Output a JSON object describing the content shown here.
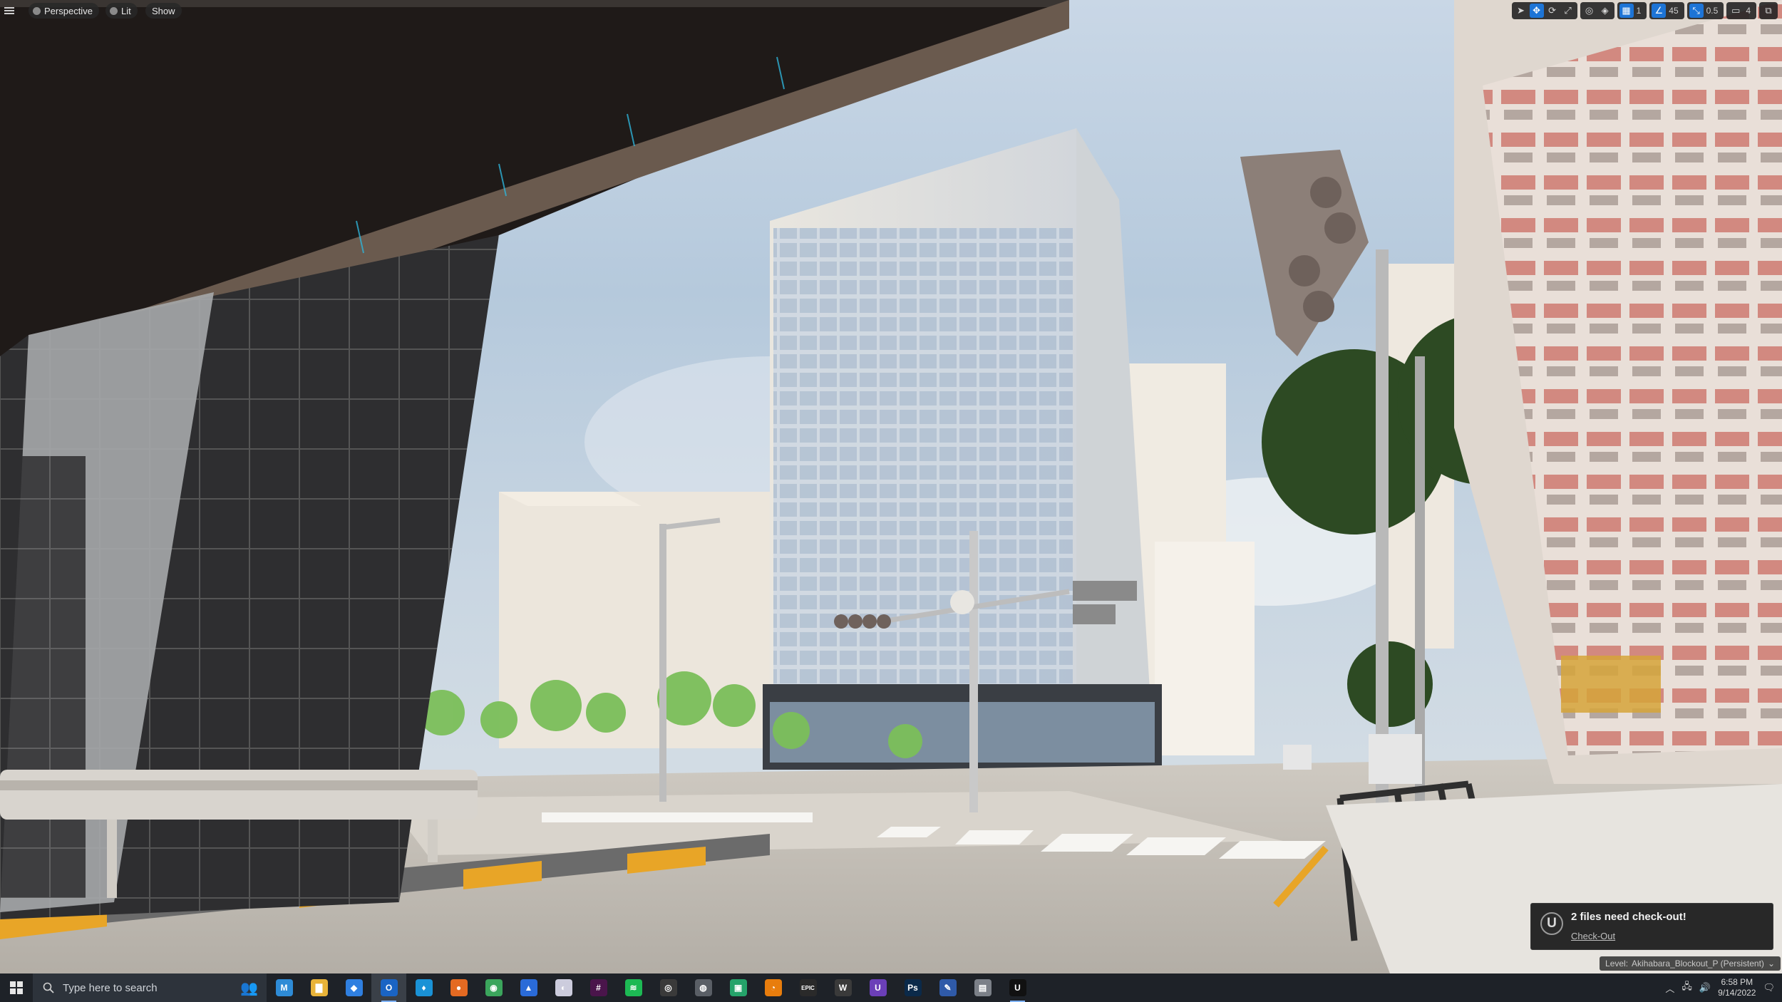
{
  "viewport": {
    "menu_icon": "hamburger-icon",
    "view_mode": "Perspective",
    "lighting_mode": "Lit",
    "show_menu": "Show"
  },
  "toolbar": {
    "grid_snap_value": "1",
    "rotation_snap_value": "45",
    "scale_snap_value": "0.5",
    "camera_speed_value": "4"
  },
  "notification": {
    "title": "2 files need check-out!",
    "action": "Check-Out"
  },
  "level": {
    "label": "Level:",
    "name": "Akihabara_Blockout_P (Persistent)"
  },
  "taskbar": {
    "search_placeholder": "Type here to search",
    "apps": [
      {
        "name": "app-m-icon",
        "glyph": "M",
        "color": "#2e8bd6"
      },
      {
        "name": "file-explorer-icon",
        "glyph": "▇",
        "color": "#e8b339"
      },
      {
        "name": "shield-app-icon",
        "glyph": "◆",
        "color": "#2f7fe0"
      },
      {
        "name": "outlook-icon",
        "glyph": "O",
        "color": "#1a64c4"
      },
      {
        "name": "security-app-icon",
        "glyph": "♦",
        "color": "#1a92d6"
      },
      {
        "name": "firefox-icon",
        "glyph": "●",
        "color": "#e46a22"
      },
      {
        "name": "chrome-icon",
        "glyph": "◉",
        "color": "#3ba55c"
      },
      {
        "name": "photos-icon",
        "glyph": "▲",
        "color": "#2a6bd8"
      },
      {
        "name": "discord-icon",
        "glyph": "◐",
        "color": "#ccccdd"
      },
      {
        "name": "slack-icon",
        "glyph": "#",
        "color": "#4a154b"
      },
      {
        "name": "spotify-icon",
        "glyph": "≋",
        "color": "#1db954"
      },
      {
        "name": "obs-icon",
        "glyph": "◎",
        "color": "#3a3a3a"
      },
      {
        "name": "media-app-icon",
        "glyph": "◍",
        "color": "#5a5f66"
      },
      {
        "name": "green-app-icon",
        "glyph": "▣",
        "color": "#25a36a"
      },
      {
        "name": "blender-icon",
        "glyph": "◔",
        "color": "#e87d0d"
      },
      {
        "name": "epic-games-icon",
        "glyph": "EPIC",
        "color": "#2a2a2a"
      },
      {
        "name": "wiki-app-icon",
        "glyph": "W",
        "color": "#3a3a3a"
      },
      {
        "name": "unreal-purple-icon",
        "glyph": "U",
        "color": "#6b3fb8"
      },
      {
        "name": "photoshop-icon",
        "glyph": "Ps",
        "color": "#0b2a4a"
      },
      {
        "name": "paint-app-icon",
        "glyph": "✎",
        "color": "#2f5aa8"
      },
      {
        "name": "storage-app-icon",
        "glyph": "▤",
        "color": "#7b8088"
      },
      {
        "name": "unreal-engine-icon",
        "glyph": "U",
        "color": "#111111"
      }
    ],
    "clock_time": "6:58 PM",
    "clock_date": "9/14/2022"
  }
}
